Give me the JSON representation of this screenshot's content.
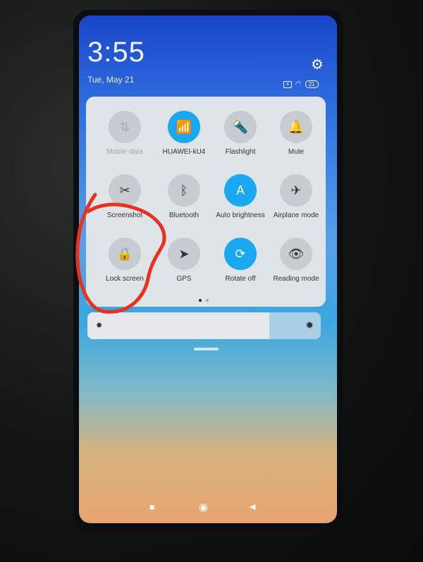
{
  "status": {
    "time": "3:55",
    "date": "Tue, May 21",
    "battery": "21",
    "icons": [
      "sim-absent-icon",
      "wifi-icon",
      "battery-icon"
    ]
  },
  "tiles": [
    {
      "label": "Mobile data",
      "icon": "mobile-data-icon",
      "glyph": "⇅",
      "state": "disabled"
    },
    {
      "label": "HUAWEI-kU4",
      "icon": "wifi-icon",
      "glyph": "📶",
      "state": "on"
    },
    {
      "label": "Flashlight",
      "icon": "flashlight-icon",
      "glyph": "🔦",
      "state": "off"
    },
    {
      "label": "Mute",
      "icon": "bell-icon",
      "glyph": "🔔",
      "state": "off"
    },
    {
      "label": "Screenshot",
      "icon": "screenshot-icon",
      "glyph": "✂",
      "state": "off"
    },
    {
      "label": "Bluetooth",
      "icon": "bluetooth-icon",
      "glyph": "ᛒ",
      "state": "off"
    },
    {
      "label": "Auto brightness",
      "icon": "auto-brightness-icon",
      "glyph": "A",
      "state": "on"
    },
    {
      "label": "Airplane mode",
      "icon": "airplane-icon",
      "glyph": "✈",
      "state": "off"
    },
    {
      "label": "Lock screen",
      "icon": "lock-icon",
      "glyph": "🔒",
      "state": "off"
    },
    {
      "label": "GPS",
      "icon": "location-arrow-icon",
      "glyph": "➤",
      "state": "off"
    },
    {
      "label": "Rotate off",
      "icon": "rotate-lock-icon",
      "glyph": "⟳",
      "state": "on"
    },
    {
      "label": "Reading mode",
      "icon": "eye-icon",
      "glyph": "👁",
      "state": "off"
    }
  ],
  "pager": {
    "pages": 2,
    "current": 1
  },
  "brightness": {
    "level_percent": 78
  },
  "colors": {
    "accent": "#1aa9f0",
    "annotation": "#e8321e"
  }
}
